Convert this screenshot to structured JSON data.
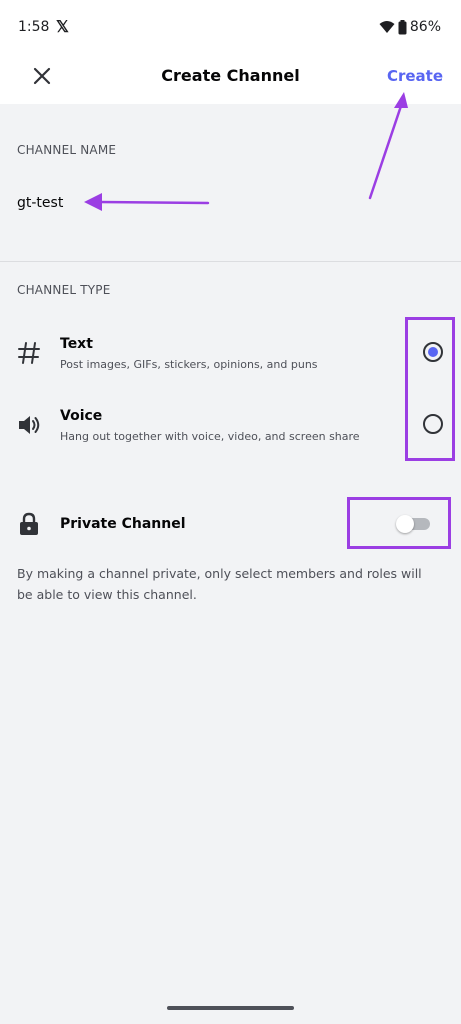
{
  "status_bar": {
    "time": "1:58",
    "x_logo": "𝕏",
    "battery": "86%"
  },
  "header": {
    "close_icon": "close-icon",
    "title": "Create Channel",
    "create_label": "Create"
  },
  "channel_name": {
    "section_label": "CHANNEL NAME",
    "value": "gt-test"
  },
  "channel_type": {
    "section_label": "CHANNEL TYPE",
    "options": [
      {
        "title": "Text",
        "description": "Post images, GIFs, stickers, opinions, and puns",
        "icon": "hash-icon",
        "selected": true
      },
      {
        "title": "Voice",
        "description": "Hang out together with voice, video, and screen share",
        "icon": "speaker-icon",
        "selected": false
      }
    ]
  },
  "private": {
    "title": "Private Channel",
    "icon": "lock-icon",
    "enabled": false,
    "description": "By making a channel private, only select members and roles will be able to view this channel."
  },
  "colors": {
    "accent": "#5865f2",
    "annotation": "#9b3ee3",
    "background": "#f2f3f5"
  }
}
